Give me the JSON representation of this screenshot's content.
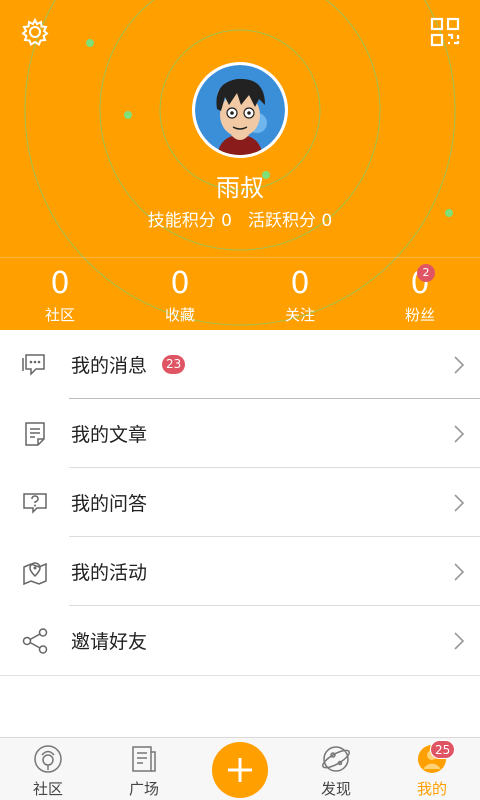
{
  "profile": {
    "username": "雨叔",
    "skill_points_label": "技能积分 0",
    "activity_points_label": "活跃积分 0"
  },
  "stats": [
    {
      "value": "0",
      "label": "社区"
    },
    {
      "value": "0",
      "label": "收藏"
    },
    {
      "value": "0",
      "label": "关注"
    },
    {
      "value": "0",
      "label": "粉丝",
      "badge": "2"
    }
  ],
  "menu": [
    {
      "label": "我的消息",
      "badge": "23",
      "icon": "message-icon"
    },
    {
      "label": "我的文章",
      "icon": "article-icon"
    },
    {
      "label": "我的问答",
      "icon": "qa-icon"
    },
    {
      "label": "我的活动",
      "icon": "map-activity-icon"
    },
    {
      "label": "邀请好友",
      "icon": "share-icon"
    }
  ],
  "tabbar": {
    "items": [
      {
        "label": "社区",
        "icon": "community-icon"
      },
      {
        "label": "广场",
        "icon": "square-list-icon"
      },
      {
        "label": "发现",
        "icon": "planet-icon"
      },
      {
        "label": "我的",
        "icon": "profile-icon",
        "badge": "25",
        "active": true
      }
    ],
    "center_icon": "plus-icon"
  },
  "colors": {
    "accent": "#ff9f00",
    "badge": "#e05563"
  }
}
